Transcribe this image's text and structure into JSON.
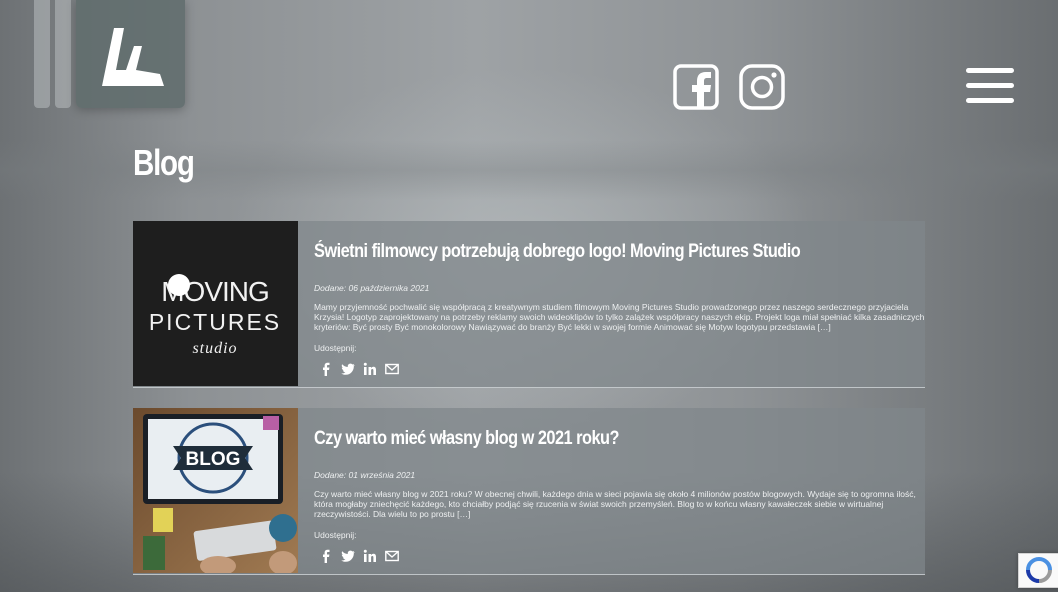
{
  "header": {
    "logo_alt": "Logo",
    "social": [
      {
        "name": "facebook-icon"
      },
      {
        "name": "instagram-icon"
      }
    ],
    "menu_icon": "hamburger-menu-icon"
  },
  "page": {
    "title": "Blog"
  },
  "posts": [
    {
      "title": "Świetni filmowcy potrzebują dobrego logo! Moving Pictures Studio",
      "date": "Dodane: 06 października 2021",
      "excerpt": "Mamy przyjemność pochwalić się współpracą z kreatywnym studiem filmowym Moving Pictures Studio prowadzonego przez naszego serdecznego przyjaciela Krzysia! Logotyp zaprojektowany na potrzeby reklamy swoich wideoklipów to tylko zalążek współpracy naszych ekip. Projekt loga miał spełniać kilka zasadniczych kryteriów: Być prosty Być monokolorowy Nawiązywać do branży Być lekki w swojej formie Animować się Motyw logotypu przedstawia […]",
      "share_label": "Udostępnij:",
      "thumb_text": {
        "line1": "MOVING",
        "line2": "PICTURES",
        "line3": "studio"
      }
    },
    {
      "title": "Czy warto mieć własny blog w 2021 roku?",
      "date": "Dodane: 01 września 2021",
      "excerpt": "Czy warto mieć własny blog w 2021 roku? W obecnej chwili, każdego dnia w sieci pojawia się około 4 milionów postów blogowych. Wydaje się to ogromna ilość, która mogłaby zniechęcić każdego, kto chciałby podjąć się rzucenia w świat swoich przemyśleń. Blog to w końcu własny kawałeczek siebie w wirtualnej rzeczywistości. Dla wielu to po prostu […]",
      "share_label": "Udostępnij:",
      "thumb_text": {
        "line1": "BLOG"
      }
    }
  ],
  "share_icons": [
    "facebook-share-icon",
    "twitter-share-icon",
    "linkedin-share-icon",
    "email-share-icon"
  ],
  "colors": {
    "text": "#ffffff",
    "card": "#80868a",
    "accent": "#ffffff"
  }
}
